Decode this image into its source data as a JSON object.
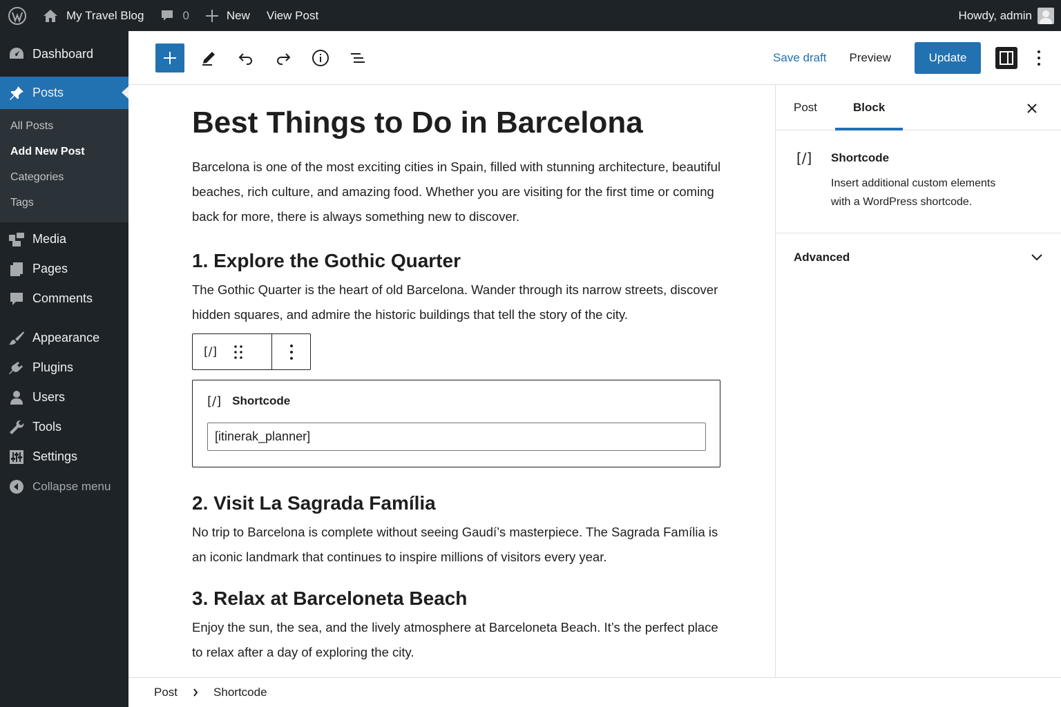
{
  "adminbar": {
    "site_name": "My Travel Blog",
    "comments_count": "0",
    "new_label": "New",
    "view_post_label": "View Post",
    "howdy_label": "Howdy, admin"
  },
  "sidebar": {
    "dashboard": "Dashboard",
    "posts": "Posts",
    "submenu": {
      "all_posts": "All Posts",
      "add_new": "Add New Post",
      "categories": "Categories",
      "tags": "Tags"
    },
    "media": "Media",
    "pages": "Pages",
    "comments": "Comments",
    "appearance": "Appearance",
    "plugins": "Plugins",
    "users": "Users",
    "tools": "Tools",
    "settings": "Settings",
    "collapse": "Collapse menu"
  },
  "header": {
    "save_draft": "Save draft",
    "preview": "Preview",
    "update": "Update"
  },
  "post": {
    "title": "Best Things to Do in Barcelona",
    "intro": "Barcelona is one of the most exciting cities in Spain, filled with stunning architecture, beautiful beaches, rich culture, and amazing food. Whether you are visiting for the first time or coming back for more, there is always something new to discover.",
    "h1": "1. Explore the Gothic Quarter",
    "p1": "The Gothic Quarter is the heart of old Barcelona. Wander through its narrow streets, discover hidden squares, and admire the historic buildings that tell the story of the city.",
    "h2": "2. Visit La Sagrada Família",
    "p2": "No trip to Barcelona is complete without seeing Gaudí’s masterpiece. The Sagrada Família is an iconic landmark that continues to inspire millions of visitors every year.",
    "h3": "3. Relax at Barceloneta Beach",
    "p3": "Enjoy the sun, the sea, and the lively atmosphere at Barceloneta Beach. It’s the perfect place to relax after a day of exploring the city."
  },
  "block_toolbar": {
    "type_icon": "[/]"
  },
  "shortcode_block": {
    "icon": "[/]",
    "label": "Shortcode",
    "value": "[itinerak_planner]"
  },
  "settings_sidebar": {
    "tab_post": "Post",
    "tab_block": "Block",
    "block_icon": "[/]",
    "block_title": "Shortcode",
    "block_description": "Insert additional custom elements with a WordPress shortcode.",
    "advanced": "Advanced"
  },
  "footer": {
    "crumb_root": "Post",
    "crumb_current": "Shortcode"
  },
  "colors": {
    "accent": "#2271b1",
    "admin_bg": "#1d2327",
    "submenu_bg": "#2c3338"
  }
}
